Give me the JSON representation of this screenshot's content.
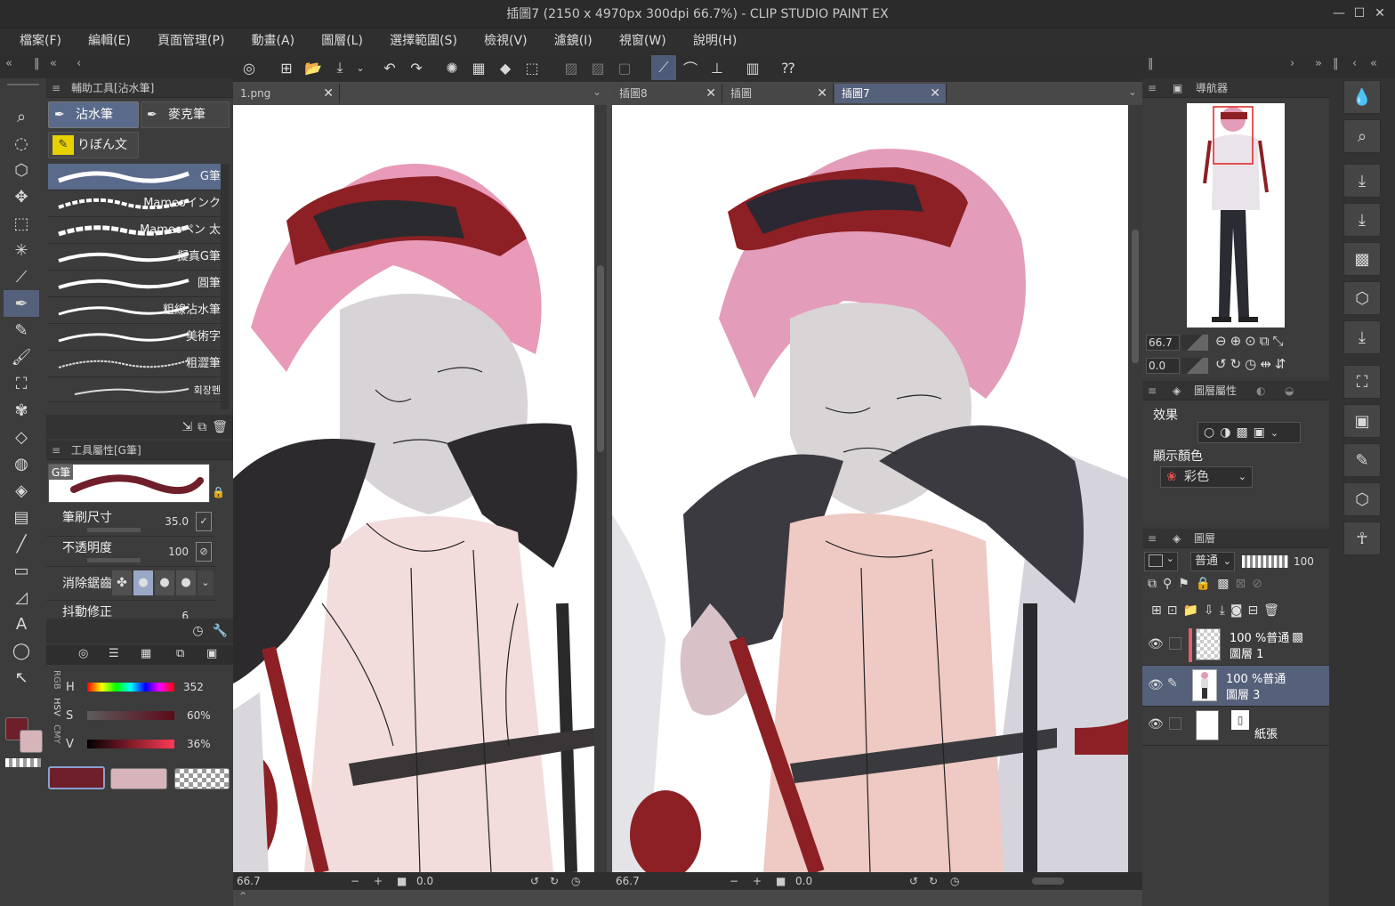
{
  "app": {
    "title": "插圖7 (2150 x 4970px 300dpi 66.7%)  - CLIP STUDIO PAINT EX",
    "window_buttons": [
      "—",
      "☐",
      "✕"
    ]
  },
  "menu": [
    "檔案(F)",
    "編輯(E)",
    "頁面管理(P)",
    "動畫(A)",
    "圖層(L)",
    "選擇範圍(S)",
    "檢視(V)",
    "濾鏡(I)",
    "視窗(W)",
    "說明(H)"
  ],
  "sub_tool_panel": {
    "header": "輔助工具[沾水筆]",
    "groups": [
      "沾水筆",
      "麥克筆",
      "りぼん文"
    ],
    "brushes": [
      "G筆",
      "Mameoインク",
      "Mameoペン 太",
      "擬真G筆",
      "圓筆",
      "粗線沾水筆",
      "美術字",
      "粗澀筆",
      "회장펜"
    ],
    "selected_brush": "G筆"
  },
  "tool_property": {
    "header": "工具屬性[G筆]",
    "preview_label": "G筆",
    "brush_size_label": "筆刷尺寸",
    "brush_size_value": "35.0",
    "opacity_label": "不透明度",
    "opacity_value": "100",
    "antialias_label": "消除鋸齒",
    "stabilization_label": "抖動修正",
    "stabilization_value": "6"
  },
  "color_panel": {
    "modes": [
      "RGB",
      "HSV",
      "CMY"
    ],
    "h_label": "H",
    "h_value": "352",
    "s_label": "S",
    "s_value": "60%",
    "v_label": "V",
    "v_value": "36%",
    "main_color": "#6e1f2a",
    "sub_color": "#d6b4b9",
    "colors": {
      "accent": "#6e1f2a",
      "sub": "#d6b4b9",
      "selection": "#55607a"
    }
  },
  "canvas_left": {
    "tab": "1.png",
    "zoom": "66.7",
    "rotation": "0.0"
  },
  "canvas_right": {
    "tabs": [
      "插圖8",
      "插圖",
      "插圖7"
    ],
    "active_tab": "插圖7",
    "zoom": "66.7",
    "rotation": "0.0"
  },
  "navigator": {
    "header": "導航器",
    "zoom": "66.7",
    "rotation": "0.0"
  },
  "layer_property": {
    "header": "圖層屬性",
    "effect_label": "效果",
    "display_color_label": "顯示顏色",
    "display_color_value": "彩色"
  },
  "layers": {
    "header": "圖層",
    "blend_mode": "普通",
    "opacity": "100",
    "items": [
      {
        "top": "100 %普通",
        "name": "圖層 1"
      },
      {
        "top": "100 %普通",
        "name": "圖層 3"
      },
      {
        "top": "",
        "name": "紙張"
      }
    ]
  },
  "icons": {
    "tools": [
      "zoom-icon",
      "lasso-icon",
      "object-select-icon",
      "move-icon",
      "marquee-icon",
      "magic-wand-icon",
      "eyedropper-icon",
      "pen-icon",
      "pencil-icon",
      "brush-icon",
      "airbrush-icon",
      "decoration-icon",
      "eraser-icon",
      "3d-icon",
      "fill-icon",
      "gradient-icon",
      "line-icon",
      "frame-icon",
      "ruler-icon",
      "text-icon",
      "balloon-icon",
      "correct-line-icon"
    ]
  }
}
